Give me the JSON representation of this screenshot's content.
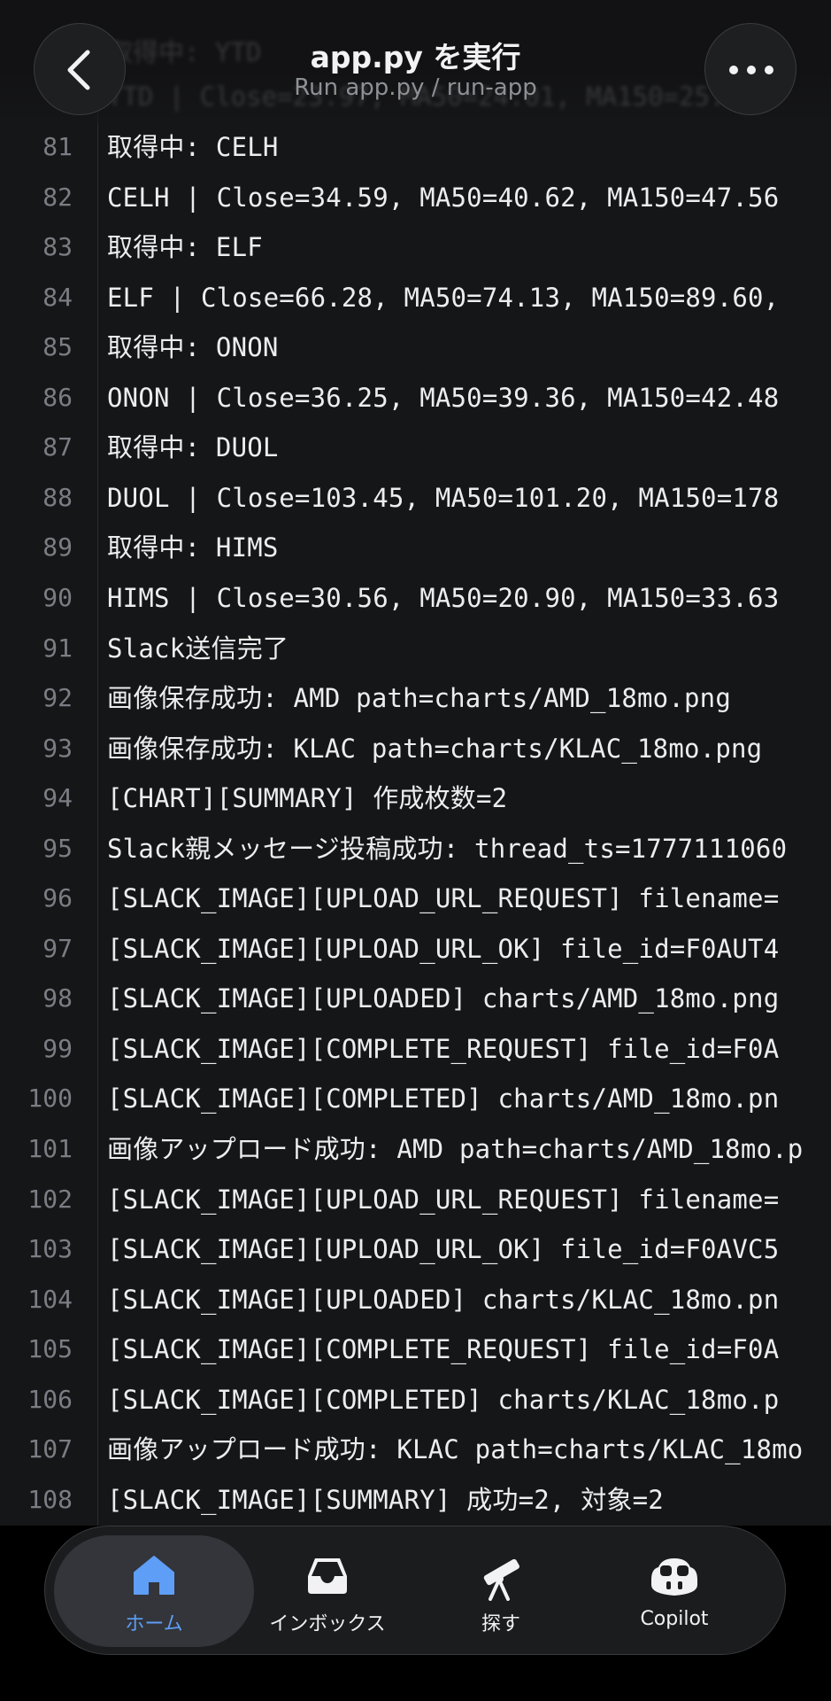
{
  "header": {
    "title": "app.py を実行",
    "subtitle": "Run app.py / run-app",
    "back_icon": "chevron-left-icon",
    "more_icon": "ellipsis-icon"
  },
  "log": {
    "ghost_lines": [
      "取得中: YTD",
      "YTD | Close=23.97, MA50=24.01, MA150=25.67,"
    ],
    "lines": [
      {
        "n": "81",
        "text": "取得中: CELH"
      },
      {
        "n": "82",
        "text": "CELH | Close=34.59, MA50=40.62, MA150=47.56"
      },
      {
        "n": "83",
        "text": "取得中: ELF"
      },
      {
        "n": "84",
        "text": "ELF | Close=66.28, MA50=74.13, MA150=89.60,"
      },
      {
        "n": "85",
        "text": "取得中: ONON"
      },
      {
        "n": "86",
        "text": "ONON | Close=36.25, MA50=39.36, MA150=42.48"
      },
      {
        "n": "87",
        "text": "取得中: DUOL"
      },
      {
        "n": "88",
        "text": "DUOL | Close=103.45, MA50=101.20, MA150=178"
      },
      {
        "n": "89",
        "text": "取得中: HIMS"
      },
      {
        "n": "90",
        "text": "HIMS | Close=30.56, MA50=20.90, MA150=33.63"
      },
      {
        "n": "91",
        "text": "Slack送信完了"
      },
      {
        "n": "92",
        "text": "画像保存成功: AMD path=charts/AMD_18mo.png"
      },
      {
        "n": "93",
        "text": "画像保存成功: KLAC path=charts/KLAC_18mo.png"
      },
      {
        "n": "94",
        "text": "[CHART][SUMMARY] 作成枚数=2"
      },
      {
        "n": "95",
        "text": "Slack親メッセージ投稿成功: thread_ts=1777111060"
      },
      {
        "n": "96",
        "text": "[SLACK_IMAGE][UPLOAD_URL_REQUEST] filename="
      },
      {
        "n": "97",
        "text": "[SLACK_IMAGE][UPLOAD_URL_OK] file_id=F0AUT4"
      },
      {
        "n": "98",
        "text": "[SLACK_IMAGE][UPLOADED] charts/AMD_18mo.png"
      },
      {
        "n": "99",
        "text": "[SLACK_IMAGE][COMPLETE_REQUEST] file_id=F0A"
      },
      {
        "n": "100",
        "text": "[SLACK_IMAGE][COMPLETED] charts/AMD_18mo.pn"
      },
      {
        "n": "101",
        "text": "画像アップロード成功: AMD path=charts/AMD_18mo.p"
      },
      {
        "n": "102",
        "text": "[SLACK_IMAGE][UPLOAD_URL_REQUEST] filename="
      },
      {
        "n": "103",
        "text": "[SLACK_IMAGE][UPLOAD_URL_OK] file_id=F0AVC5"
      },
      {
        "n": "104",
        "text": "[SLACK_IMAGE][UPLOADED] charts/KLAC_18mo.pn"
      },
      {
        "n": "105",
        "text": "[SLACK_IMAGE][COMPLETE_REQUEST] file_id=F0A"
      },
      {
        "n": "106",
        "text": "[SLACK_IMAGE][COMPLETED] charts/KLAC_18mo.p"
      },
      {
        "n": "107",
        "text": "画像アップロード成功: KLAC path=charts/KLAC_18mo"
      },
      {
        "n": "108",
        "text": "[SLACK_IMAGE][SUMMARY] 成功=2, 対象=2"
      }
    ]
  },
  "tabbar": {
    "tabs": [
      {
        "label": "ホーム",
        "icon": "home-icon",
        "active": true
      },
      {
        "label": "インボックス",
        "icon": "inbox-icon",
        "active": false
      },
      {
        "label": "探す",
        "icon": "telescope-icon",
        "active": false
      },
      {
        "label": "Copilot",
        "icon": "copilot-icon",
        "active": false
      }
    ]
  },
  "colors": {
    "background": "#151617",
    "text": "#ecedef",
    "line_number": "#7a7d83",
    "accent": "#5e9ef7"
  }
}
